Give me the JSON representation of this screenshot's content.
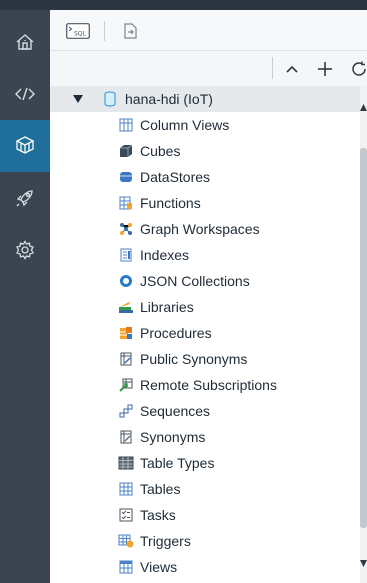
{
  "tree": {
    "root": {
      "label": "hana-hdi (IoT)",
      "expanded": true
    },
    "items": [
      {
        "label": "Column Views",
        "icon": "column-views-icon"
      },
      {
        "label": "Cubes",
        "icon": "cube-icon"
      },
      {
        "label": "DataStores",
        "icon": "datastore-icon"
      },
      {
        "label": "Functions",
        "icon": "function-icon"
      },
      {
        "label": "Graph Workspaces",
        "icon": "graph-icon"
      },
      {
        "label": "Indexes",
        "icon": "index-icon"
      },
      {
        "label": "JSON Collections",
        "icon": "json-icon"
      },
      {
        "label": "Libraries",
        "icon": "library-icon"
      },
      {
        "label": "Procedures",
        "icon": "procedure-icon"
      },
      {
        "label": "Public Synonyms",
        "icon": "public-synonym-icon"
      },
      {
        "label": "Remote Subscriptions",
        "icon": "remote-subscription-icon"
      },
      {
        "label": "Sequences",
        "icon": "sequence-icon"
      },
      {
        "label": "Synonyms",
        "icon": "synonym-icon"
      },
      {
        "label": "Table Types",
        "icon": "table-type-icon"
      },
      {
        "label": "Tables",
        "icon": "table-icon"
      },
      {
        "label": "Tasks",
        "icon": "task-icon"
      },
      {
        "label": "Triggers",
        "icon": "trigger-icon"
      },
      {
        "label": "Views",
        "icon": "view-icon"
      }
    ]
  },
  "sidebar": {
    "items": [
      {
        "name": "home",
        "icon": "home-icon"
      },
      {
        "name": "code",
        "icon": "code-icon"
      },
      {
        "name": "database-explorer",
        "icon": "database-explorer-icon",
        "active": true
      },
      {
        "name": "deploy",
        "icon": "rocket-icon"
      },
      {
        "name": "settings",
        "icon": "gear-icon"
      }
    ]
  },
  "toolbar": {
    "sql_console_icon": "sql-console-icon",
    "import_icon": "import-icon",
    "collapse_icon": "collapse-icon",
    "add_icon": "add-icon",
    "refresh_icon": "refresh-icon",
    "sql_label": "SQL"
  },
  "colors": {
    "sidebar_bg": "#3b4551",
    "sidebar_active": "#1f6f9a",
    "tree_root_bg": "#e6e9ec",
    "text": "#1f2b36"
  }
}
